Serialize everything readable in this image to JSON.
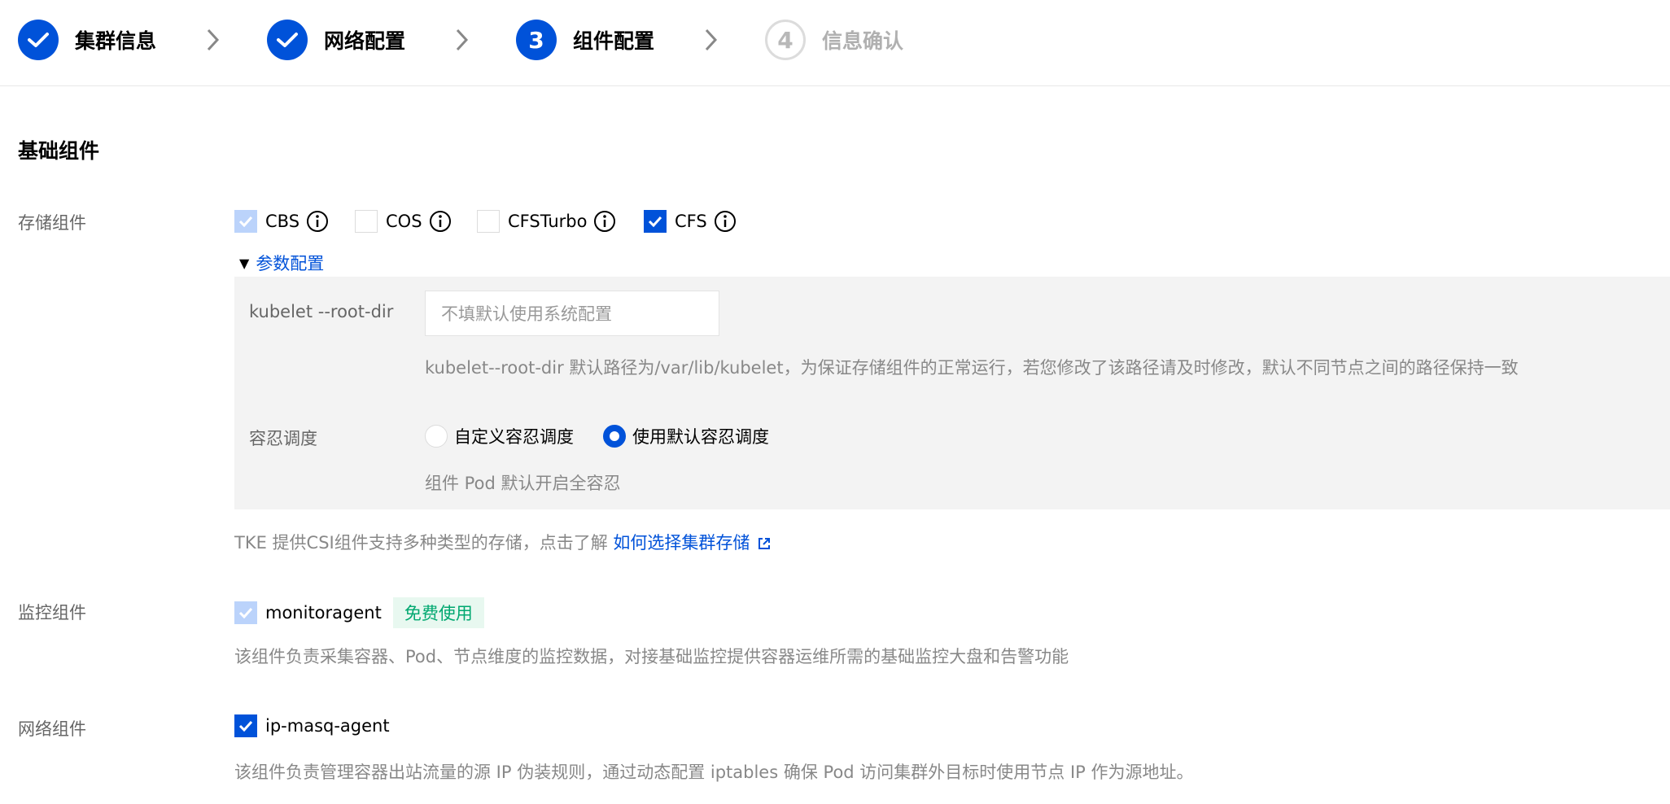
{
  "steps": [
    {
      "label": "集群信息",
      "state": "done"
    },
    {
      "label": "网络配置",
      "state": "done"
    },
    {
      "number": "3",
      "label": "组件配置",
      "state": "active"
    },
    {
      "number": "4",
      "label": "信息确认",
      "state": "pending"
    }
  ],
  "section_title": "基础组件",
  "storage": {
    "label": "存储组件",
    "options": [
      {
        "label": "CBS",
        "state": "disabled-checked"
      },
      {
        "label": "COS",
        "state": "unchecked"
      },
      {
        "label": "CFSTurbo",
        "state": "unchecked"
      },
      {
        "label": "CFS",
        "state": "checked"
      }
    ],
    "param_toggle": "参数配置",
    "params": {
      "root_dir_label": "kubelet --root-dir",
      "root_dir_placeholder": "不填默认使用系统配置",
      "root_dir_help": "kubelet--root-dir 默认路径为/var/lib/kubelet，为保证存储组件的正常运行，若您修改了该路径请及时修改，默认不同节点之间的路径保持一致",
      "toleration_label": "容忍调度",
      "toleration_options": [
        "自定义容忍调度",
        "使用默认容忍调度"
      ],
      "toleration_selected": "使用默认容忍调度",
      "toleration_help": "组件 Pod 默认开启全容忍"
    },
    "help_prefix": "TKE 提供CSI组件支持多种类型的存储，点击了解 ",
    "help_link": "如何选择集群存储"
  },
  "monitor": {
    "label": "监控组件",
    "option": "monitoragent",
    "badge": "免费使用",
    "help": "该组件负责采集容器、Pod、节点维度的监控数据，对接基础监控提供容器运维所需的基础监控大盘和告警功能"
  },
  "network": {
    "label": "网络组件",
    "option": "ip-masq-agent",
    "help": "该组件负责管理容器出站流量的源 IP 伪装规则，通过动态配置 iptables 确保 Pod 访问集群外目标时使用节点 IP 作为源地址。"
  },
  "colors": {
    "primary": "#0052d9",
    "badge_bg": "#e8f8f0",
    "badge_text": "#00a870",
    "panel_bg": "#f3f3f3"
  }
}
